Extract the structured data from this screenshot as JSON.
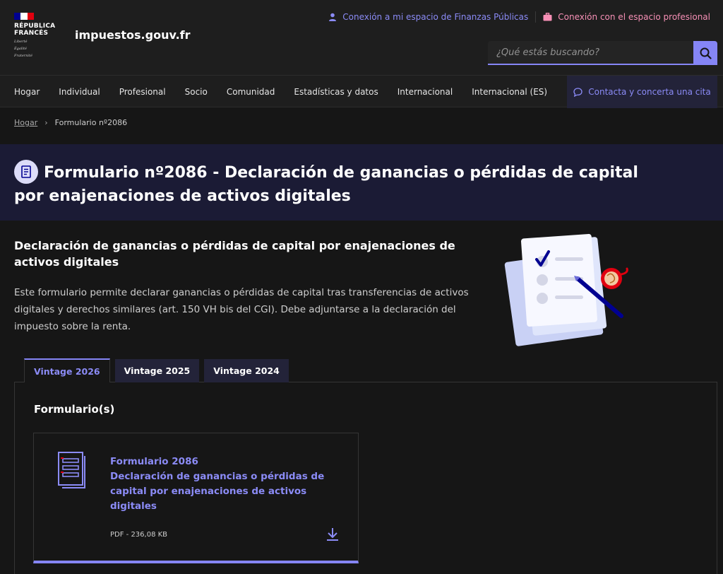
{
  "header": {
    "logo_line1": "RÉPUBLICA",
    "logo_line2": "FRANCÉS",
    "motto_1": "Liberté",
    "motto_2": "Égalité",
    "motto_3": "Fraternité",
    "site_name": "impuestos.gouv.fr",
    "link_personal": "Conexión a mi espacio de Finanzas Públicas",
    "link_pro": "Conexión con el espacio profesional",
    "search_placeholder": "¿Qué estás buscando?"
  },
  "nav": {
    "items": [
      "Hogar",
      "Individual",
      "Profesional",
      "Socio",
      "Comunidad",
      "Estadísticas y datos",
      "Internacional",
      "Internacional (ES)"
    ],
    "contact": "Contacta y concerta una cita"
  },
  "breadcrumb": {
    "home": "Hogar",
    "current": "Formulario nº2086"
  },
  "page": {
    "title": "Formulario nº2086 - Declaración de ganancias o pérdidas de capital por enajenaciones de activos digitales",
    "intro_title": "Declaración de ganancias o pérdidas de capital por enajenaciones de activos digitales",
    "intro_text": "Este formulario permite declarar ganancias o pérdidas de capital tras transferencias de activos digitales y derechos similares (art. 150 VH bis del CGI). Debe adjuntarse a la declaración del impuesto sobre la renta."
  },
  "tabs": [
    "Vintage 2026",
    "Vintage 2025",
    "Vintage 2024"
  ],
  "panel": {
    "title": "Formulario(s)",
    "card_title_1": "Formulario 2086",
    "card_title_2": "Declaración de ganancias o pérdidas de capital por enajenaciones de activos digitales",
    "card_meta": "PDF - 236,08 KB"
  },
  "colors": {
    "accent": "#8585f6",
    "pro_link": "#f790b6",
    "banner_bg": "#1b1b35",
    "flag_blue": "#000091",
    "flag_red": "#e1000f"
  },
  "icons": [
    "user-icon",
    "briefcase-icon",
    "search-icon",
    "chat-bubble-icon",
    "chevron-right-icon",
    "document-icon",
    "download-icon"
  ]
}
